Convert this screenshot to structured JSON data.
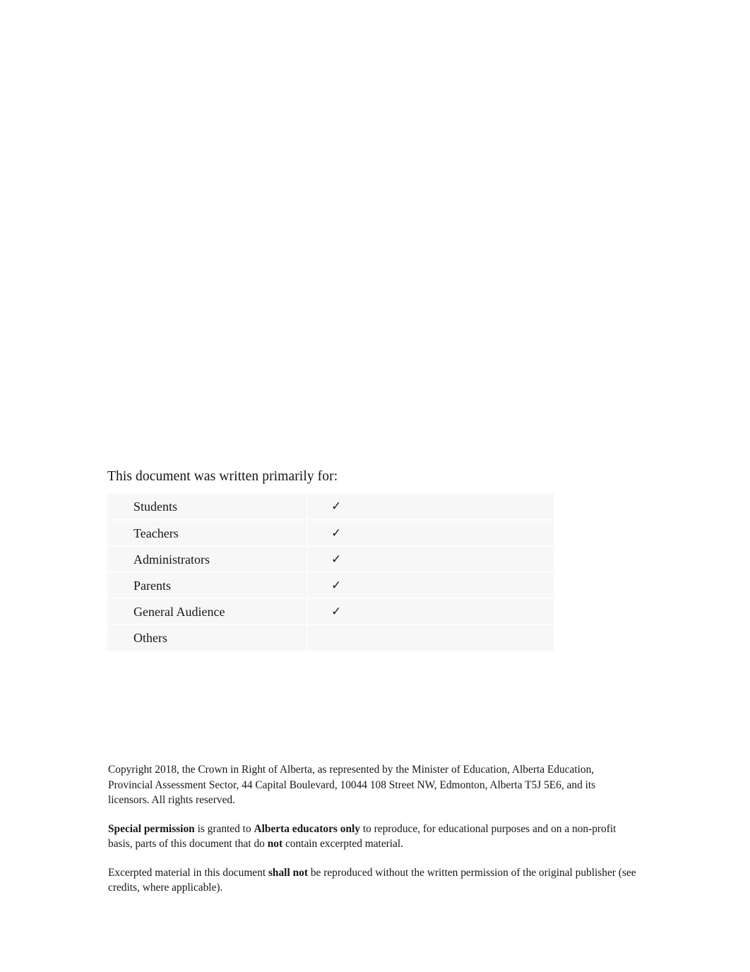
{
  "page": {
    "background_color": "#ffffff",
    "text_color": "#171717"
  },
  "audience": {
    "heading": "This document was written primarily for:",
    "table": {
      "background_color": "#f7f7f8",
      "separator_color": "#fdfdfd",
      "check_symbol": "✓",
      "rows": [
        {
          "label": "Students",
          "checked": true,
          "mark": "✓"
        },
        {
          "label": "Teachers",
          "checked": true,
          "mark": "✓"
        },
        {
          "label": "Administrators",
          "checked": true,
          "mark": "✓"
        },
        {
          "label": "Parents",
          "checked": true,
          "mark": "✓"
        },
        {
          "label": "General Audience",
          "checked": true,
          "mark": "✓"
        },
        {
          "label": "Others",
          "checked": false,
          "mark": ""
        }
      ]
    }
  },
  "legal": {
    "paragraphs": [
      {
        "id": "copyright",
        "runs": [
          {
            "text": "Copyright 2018, the Crown in Right of Alberta, as represented by the Minister of Education, Alberta Education, Provincial Assessment Sector, 44 Capital Boulevard, 10044 108 Street NW, Edmonton, Alberta T5J 5E6, and its licensors. All rights reserved.",
            "bold": false
          }
        ]
      },
      {
        "id": "special-permission",
        "runs": [
          {
            "text": "Special permission",
            "bold": true
          },
          {
            "text": " is granted to ",
            "bold": false
          },
          {
            "text": "Alberta educators only",
            "bold": true
          },
          {
            "text": " to reproduce, for educational purposes and on a non-profit basis, parts of this document that do ",
            "bold": false
          },
          {
            "text": "not",
            "bold": true
          },
          {
            "text": " contain excerpted material.",
            "bold": false
          }
        ]
      },
      {
        "id": "excerpted-material",
        "runs": [
          {
            "text": "Excerpted material in this document ",
            "bold": false
          },
          {
            "text": "shall not",
            "bold": true
          },
          {
            "text": " be reproduced without the written permission of the original publisher (see credits, where applicable).",
            "bold": false
          }
        ]
      }
    ]
  }
}
